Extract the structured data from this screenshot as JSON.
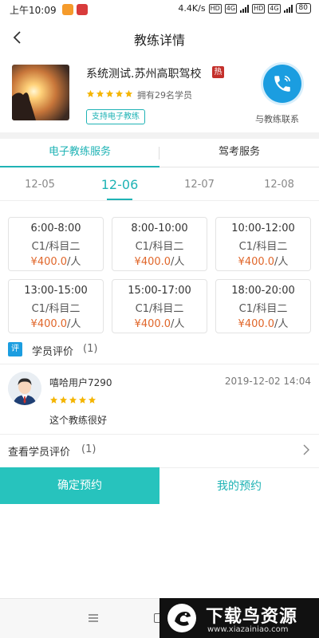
{
  "status_bar": {
    "time": "上午10:09",
    "speed": "4.4K/s",
    "net_tag_1": "HD",
    "net_tag_2": "4G",
    "net_tag_3": "HD",
    "net_tag_4": "4G",
    "battery": "80"
  },
  "header": {
    "title": "教练详情"
  },
  "coach": {
    "name": "系统测试.苏州高职驾校",
    "hot_badge": "热",
    "rating_stars": 5,
    "students": "拥有29名学员",
    "support_tag": "支持电子教练",
    "contact_label": "与教练联系"
  },
  "tabs": [
    {
      "label": "电子教练服务",
      "active": true
    },
    {
      "label": "驾考服务",
      "active": false
    }
  ],
  "dates": [
    {
      "label": "12-05",
      "active": false
    },
    {
      "label": "12-06",
      "active": true
    },
    {
      "label": "12-07",
      "active": false
    },
    {
      "label": "12-08",
      "active": false
    }
  ],
  "slots": [
    {
      "time": "6:00-8:00",
      "course": "C1/科目二",
      "price": "¥400.0",
      "unit": "/人"
    },
    {
      "time": "8:00-10:00",
      "course": "C1/科目二",
      "price": "¥400.0",
      "unit": "/人"
    },
    {
      "time": "10:00-12:00",
      "course": "C1/科目二",
      "price": "¥400.0",
      "unit": "/人"
    },
    {
      "time": "13:00-15:00",
      "course": "C1/科目二",
      "price": "¥400.0",
      "unit": "/人"
    },
    {
      "time": "15:00-17:00",
      "course": "C1/科目二",
      "price": "¥400.0",
      "unit": "/人"
    },
    {
      "time": "18:00-20:00",
      "course": "C1/科目二",
      "price": "¥400.0",
      "unit": "/人"
    }
  ],
  "reviews": {
    "badge": "评",
    "title": "学员评价",
    "count": "(1)",
    "items": [
      {
        "user": "嘻哈用户7290",
        "time": "2019-12-02 14:04",
        "stars": 5,
        "text": "这个教练很好"
      }
    ],
    "view_all_label": "查看学员评价",
    "view_all_count": "(1)"
  },
  "actions": {
    "confirm": "确定预约",
    "mine": "我的预约"
  },
  "watermark": {
    "big": "下载鸟资源",
    "small": "www.xiazainiao.com"
  },
  "colors": {
    "accent": "#1fb3b5",
    "confirm_bg": "#27c3bd",
    "price": "#e0662a",
    "star": "#f4b400",
    "call": "#1b9de0"
  },
  "icons": [
    "back-arrow-icon",
    "phone-icon",
    "star-icon",
    "chevron-right-icon",
    "menu-icon",
    "home-icon"
  ]
}
